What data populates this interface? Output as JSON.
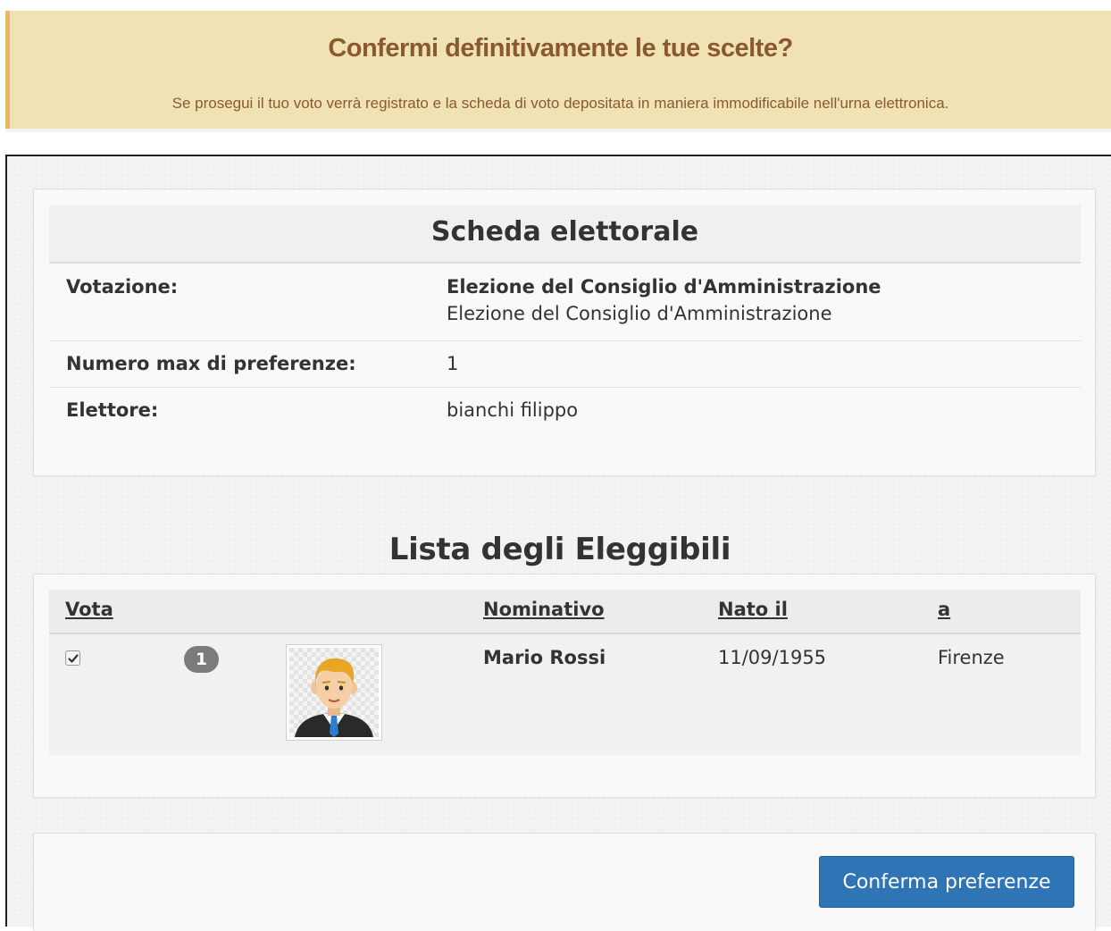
{
  "alert": {
    "title": "Confermi definitivamente le tue scelte?",
    "message": "Se prosegui il tuo voto verrà registrato e la scheda di voto depositata in maniera immodificabile nell'urna elettronica."
  },
  "scheda": {
    "title": "Scheda elettorale",
    "votazione_label": "Votazione:",
    "votazione_title": "Elezione del Consiglio d'Amministrazione",
    "votazione_desc": "Elezione del Consiglio d'Amministrazione",
    "max_pref_label": "Numero max di preferenze:",
    "max_pref_value": "1",
    "elettore_label": "Elettore:",
    "elettore_value": "bianchi filippo"
  },
  "lista": {
    "title": "Lista degli Eleggibili",
    "headers": {
      "vota": "Vota",
      "nominativo": "Nominativo",
      "nato_il": "Nato il",
      "luogo": "a"
    },
    "rows": [
      {
        "checked": true,
        "number": "1",
        "photo": "candidate-avatar",
        "nominativo": "Mario Rossi",
        "nato_il": "11/09/1955",
        "luogo": "Firenze"
      }
    ]
  },
  "footer": {
    "confirm_label": "Conferma preferenze"
  },
  "colors": {
    "alert_bg": "#f0e2b4",
    "alert_text": "#8a5a2f",
    "primary_button": "#2f75b5"
  }
}
